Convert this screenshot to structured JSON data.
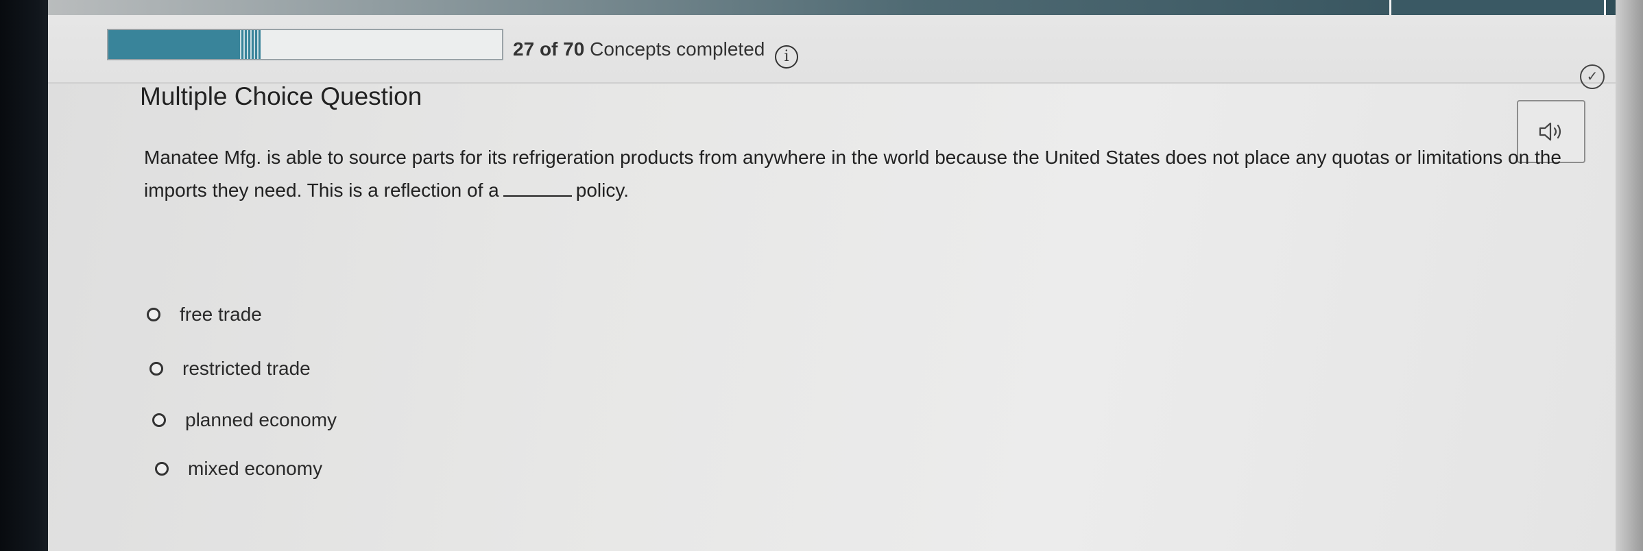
{
  "progress": {
    "completed": "27",
    "total": "70",
    "suffix": "Concepts completed",
    "fraction": 0.386
  },
  "header": {
    "info_glyph": "i",
    "check_glyph": "✓"
  },
  "question": {
    "title": "Multiple Choice Question",
    "text_before_blank": "Manatee Mfg. is able to source parts for its refrigeration products from anywhere in the world because the United States does not place any quotas or limitations on the imports they need. This is a reflection of a",
    "text_after_blank": "policy."
  },
  "options": [
    {
      "label": "free trade",
      "selected": false
    },
    {
      "label": "restricted trade",
      "selected": false
    },
    {
      "label": "planned economy",
      "selected": false
    },
    {
      "label": "mixed economy",
      "selected": false
    }
  ],
  "colors": {
    "progress_fill": "#39849a",
    "accent": "#2f4d58"
  }
}
